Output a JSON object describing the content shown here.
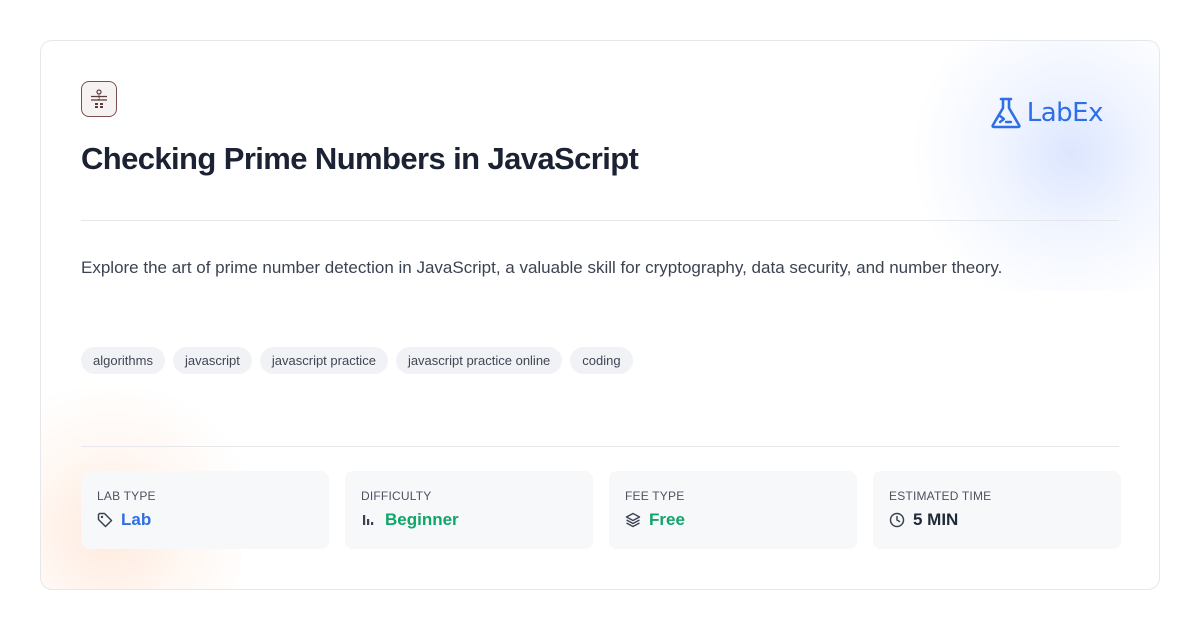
{
  "brand": {
    "name": "LabEx",
    "color": "#2f6fe4",
    "icon": "flask-terminal-icon"
  },
  "course_icon": "prime-calculator-icon",
  "title": "Checking Prime Numbers in JavaScript",
  "description": "Explore the art of prime number detection in JavaScript, a valuable skill for cryptography, data security, and number theory.",
  "tags": [
    "algorithms",
    "javascript",
    "javascript practice",
    "javascript practice online",
    "coding"
  ],
  "stats": [
    {
      "label": "LAB TYPE",
      "value": "Lab",
      "icon": "tag-icon",
      "color": "#2f6fe4"
    },
    {
      "label": "DIFFICULTY",
      "value": "Beginner",
      "icon": "signal-bars-icon",
      "color": "#10a56a"
    },
    {
      "label": "FEE TYPE",
      "value": "Free",
      "icon": "layers-icon",
      "color": "#10a56a"
    },
    {
      "label": "ESTIMATED TIME",
      "value": "5 MIN",
      "icon": "clock-icon",
      "color": "#1f2937"
    }
  ]
}
